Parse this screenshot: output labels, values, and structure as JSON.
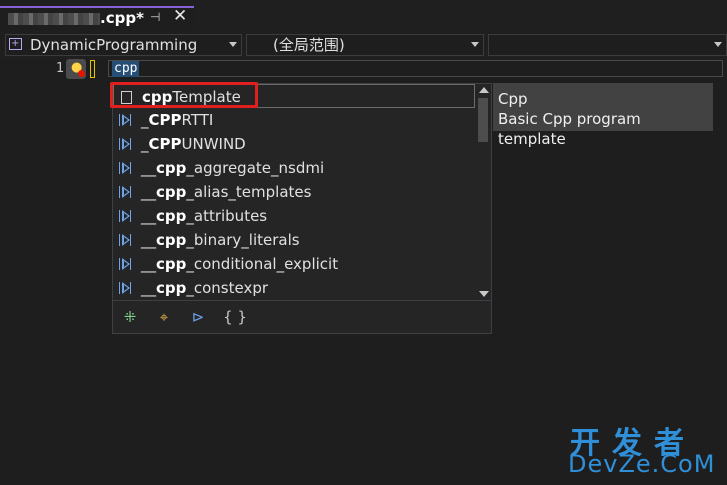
{
  "tab": {
    "title": ".cpp*"
  },
  "nav": {
    "project": "DynamicProgramming",
    "scope": "(全局范围)",
    "member": ""
  },
  "editor": {
    "line_number": "1",
    "typed_text": "cpp"
  },
  "completion": {
    "items": [
      {
        "icon": "template-icon",
        "prefix": "",
        "match": "cpp",
        "suffix": "Template"
      },
      {
        "icon": "keyword-icon",
        "prefix": "_",
        "match": "CPP",
        "suffix": "RTTI"
      },
      {
        "icon": "keyword-icon",
        "prefix": "_",
        "match": "CPP",
        "suffix": "UNWIND"
      },
      {
        "icon": "keyword-icon",
        "prefix": "__",
        "match": "cpp",
        "suffix": "_aggregate_nsdmi"
      },
      {
        "icon": "keyword-icon",
        "prefix": "__",
        "match": "cpp",
        "suffix": "_alias_templates"
      },
      {
        "icon": "keyword-icon",
        "prefix": "__",
        "match": "cpp",
        "suffix": "_attributes"
      },
      {
        "icon": "keyword-icon",
        "prefix": "__",
        "match": "cpp",
        "suffix": "_binary_literals"
      },
      {
        "icon": "keyword-icon",
        "prefix": "__",
        "match": "cpp",
        "suffix": "_conditional_explicit"
      },
      {
        "icon": "keyword-icon",
        "prefix": "__",
        "match": "cpp",
        "suffix": "_constexpr"
      }
    ],
    "filters": [
      "⁜",
      "⌖",
      "⊳",
      "{ }"
    ]
  },
  "tooltip": {
    "title": "Cpp",
    "description": "Basic Cpp program template"
  },
  "watermark": {
    "cn": "开发者",
    "en": "DevZe.CoM"
  },
  "colors": {
    "accent": "#8763d6",
    "highlight": "#e01f1f",
    "selection": "#264f78",
    "watermark": "#2f8fd8"
  }
}
